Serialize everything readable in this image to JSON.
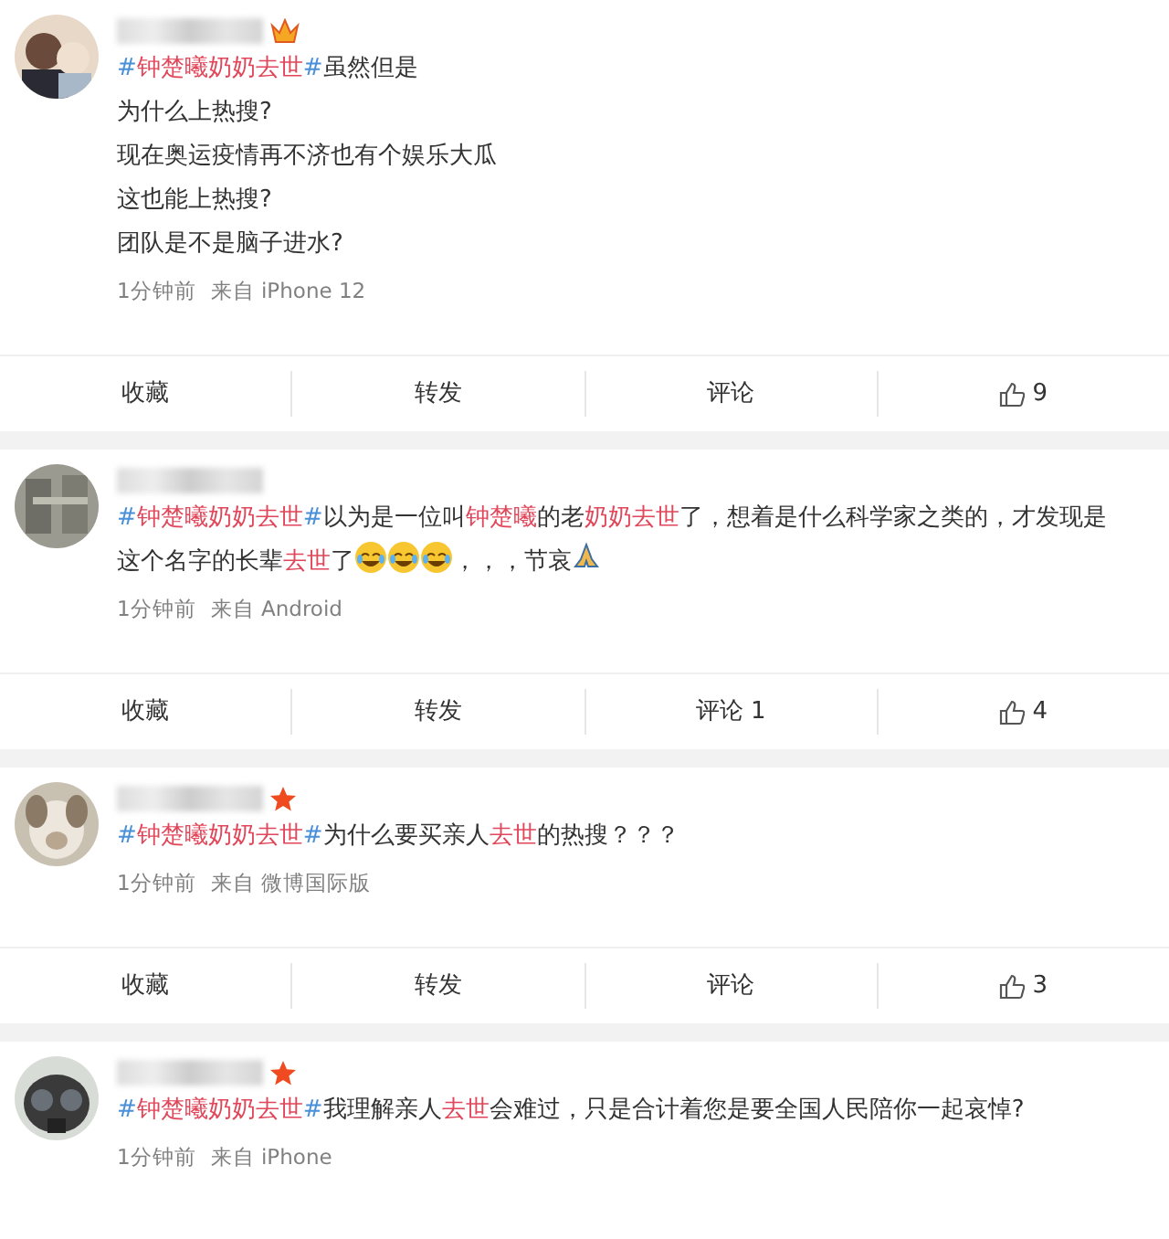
{
  "posts": [
    {
      "crown": true,
      "star": false,
      "lines": [
        [
          {
            "kind": "hash",
            "text": "#"
          },
          {
            "kind": "hl",
            "text": "钟楚曦奶奶去世"
          },
          {
            "kind": "hash",
            "text": "#"
          },
          {
            "kind": "text",
            "text": "虽然但是"
          }
        ],
        [
          {
            "kind": "text",
            "text": "为什么上热搜?"
          }
        ],
        [
          {
            "kind": "text",
            "text": "现在奥运疫情再不济也有个娱乐大瓜"
          }
        ],
        [
          {
            "kind": "text",
            "text": "这也能上热搜?"
          }
        ],
        [
          {
            "kind": "text",
            "text": "团队是不是脑子进水?"
          }
        ]
      ],
      "time": "1分钟前",
      "source": "来自 iPhone 12",
      "actions": [
        "收藏",
        "转发",
        "评论"
      ],
      "likes": "9"
    },
    {
      "crown": false,
      "star": false,
      "lines": [
        [
          {
            "kind": "hash",
            "text": "#"
          },
          {
            "kind": "hl",
            "text": "钟楚曦奶奶去世"
          },
          {
            "kind": "hash",
            "text": "#"
          },
          {
            "kind": "text",
            "text": "以为是一位叫"
          },
          {
            "kind": "hl",
            "text": "钟楚曦"
          },
          {
            "kind": "text",
            "text": "的老"
          },
          {
            "kind": "hl",
            "text": "奶奶去世"
          },
          {
            "kind": "text",
            "text": "了，想着是什么科学家之类的，才发现是"
          }
        ],
        [
          {
            "kind": "text",
            "text": "这个名字的长辈"
          },
          {
            "kind": "hl",
            "text": "去世"
          },
          {
            "kind": "text",
            "text": "了"
          },
          {
            "kind": "laugh"
          },
          {
            "kind": "laugh"
          },
          {
            "kind": "laugh"
          },
          {
            "kind": "text",
            "text": "，，，节哀"
          },
          {
            "kind": "pray"
          }
        ]
      ],
      "time": "1分钟前",
      "source": "来自 Android",
      "actions": [
        "收藏",
        "转发",
        "评论 1"
      ],
      "likes": "4"
    },
    {
      "crown": false,
      "star": true,
      "lines": [
        [
          {
            "kind": "hash",
            "text": "#"
          },
          {
            "kind": "hl",
            "text": "钟楚曦奶奶去世"
          },
          {
            "kind": "hash",
            "text": "#"
          },
          {
            "kind": "text",
            "text": "为什么要买亲人"
          },
          {
            "kind": "hl",
            "text": "去世"
          },
          {
            "kind": "text",
            "text": "的热搜？？？"
          }
        ]
      ],
      "time": "1分钟前",
      "source": "来自 微博国际版",
      "actions": [
        "收藏",
        "转发",
        "评论"
      ],
      "likes": "3"
    },
    {
      "crown": false,
      "star": true,
      "lines": [
        [
          {
            "kind": "hash",
            "text": "#"
          },
          {
            "kind": "hl",
            "text": "钟楚曦奶奶去世"
          },
          {
            "kind": "hash",
            "text": "#"
          },
          {
            "kind": "text",
            "text": "我理解亲人"
          },
          {
            "kind": "hl",
            "text": "去世"
          },
          {
            "kind": "text",
            "text": "会难过，只是合计着您是要全国人民陪你一起哀悼?"
          }
        ]
      ],
      "time": "1分钟前",
      "source": "来自 iPhone"
    }
  ]
}
